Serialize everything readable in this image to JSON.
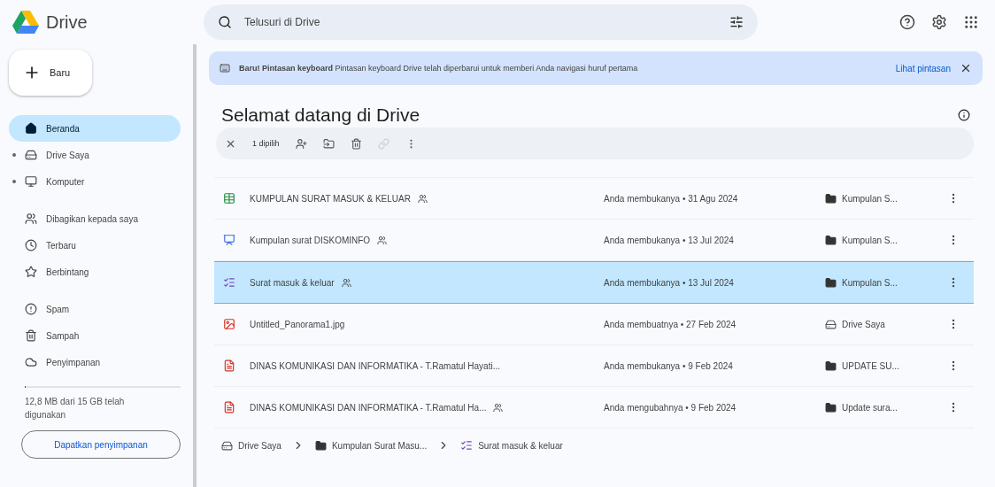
{
  "app": {
    "name": "Drive"
  },
  "search": {
    "placeholder": "Telusuri di Drive"
  },
  "new_button": {
    "label": "Baru"
  },
  "sidebar": {
    "groups": [
      [
        {
          "label": "Beranda",
          "selected": true
        },
        {
          "label": "Drive Saya",
          "selected": false,
          "expanded": false
        },
        {
          "label": "Komputer",
          "selected": false,
          "expanded": false
        }
      ],
      [
        {
          "label": "Dibagikan kepada saya",
          "selected": false
        },
        {
          "label": "Terbaru",
          "selected": false
        },
        {
          "label": "Berbintang",
          "selected": false
        }
      ],
      [
        {
          "label": "Spam",
          "selected": false
        },
        {
          "label": "Sampah",
          "selected": false
        },
        {
          "label": "Penyimpanan",
          "selected": false
        }
      ]
    ],
    "storage": {
      "text": "12,8 MB dari 15 GB telah digunakan",
      "level": 0.001
    },
    "storage_button": "Dapatkan penyimpanan"
  },
  "banner": {
    "title": "Baru! Pintasan keyboard",
    "message": "Pintasan keyboard Drive telah diperbarui untuk memberi Anda navigasi huruf pertama",
    "link": "Lihat pintasan"
  },
  "heading": "Selamat datang di Drive",
  "selection_bar": {
    "count": "1 dipilih"
  },
  "rows": [
    {
      "kind": "sheet",
      "name": "KUMPULAN SURAT MASUK & KELUAR",
      "shared": true,
      "activity": "Anda membukanya • 31 Agu 2024",
      "location": {
        "kind": "folder",
        "label": "Kumpulan S..."
      },
      "selected": false
    },
    {
      "kind": "slides",
      "name": "Kumpulan surat DISKOMINFO",
      "shared": true,
      "activity": "Anda membukanya • 13 Jul 2024",
      "location": {
        "kind": "folder",
        "label": "Kumpulan S..."
      },
      "selected": false
    },
    {
      "kind": "form",
      "name": "Surat masuk & keluar",
      "shared": true,
      "activity": "Anda membukanya • 13 Jul 2024",
      "location": {
        "kind": "folder",
        "label": "Kumpulan S..."
      },
      "selected": true
    },
    {
      "kind": "image",
      "name": "Untitled_Panorama1.jpg",
      "shared": false,
      "activity": "Anda membuatnya • 27 Feb 2024",
      "location": {
        "kind": "drive",
        "label": "Drive Saya"
      },
      "selected": false
    },
    {
      "kind": "pdf",
      "name": "DINAS KOMUNIKASI DAN INFORMATIKA - T.Ramatul Hayati...",
      "shared": false,
      "activity": "Anda membukanya • 9 Feb 2024",
      "location": {
        "kind": "folder",
        "label": "UPDATE SU..."
      },
      "selected": false
    },
    {
      "kind": "pdf",
      "name": "DINAS KOMUNIKASI DAN INFORMATIKA - T.Ramatul Ha...",
      "shared": true,
      "activity": "Anda mengubahnya • 9 Feb 2024",
      "location": {
        "kind": "folder",
        "label": "Update sura..."
      },
      "selected": false
    }
  ],
  "breadcrumb": [
    {
      "kind": "drive",
      "label": "Drive Saya"
    },
    {
      "kind": "folder",
      "label": "Kumpulan Surat Masu..."
    },
    {
      "kind": "form",
      "label": "Surat masuk & keluar"
    }
  ]
}
